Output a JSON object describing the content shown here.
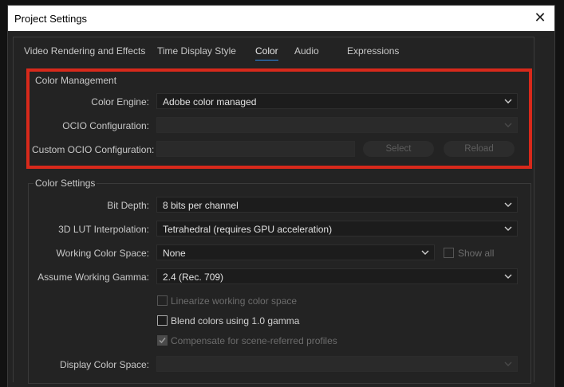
{
  "window": {
    "title": "Project Settings"
  },
  "tabs": [
    {
      "label": "Video Rendering and Effects"
    },
    {
      "label": "Time Display Style"
    },
    {
      "label": "Color",
      "active": true
    },
    {
      "label": "Audio"
    },
    {
      "label": "Expressions"
    }
  ],
  "color_management": {
    "title": "Color Management",
    "engine_label": "Color Engine:",
    "engine_value": "Adobe color managed",
    "ocio_label": "OCIO Configuration:",
    "ocio_value": "",
    "custom_ocio_label": "Custom OCIO Configuration:",
    "custom_ocio_value": "",
    "select_label": "Select",
    "reload_label": "Reload"
  },
  "color_settings": {
    "title": "Color Settings",
    "bit_depth_label": "Bit Depth:",
    "bit_depth_value": "8 bits per channel",
    "lut_label": "3D LUT Interpolation:",
    "lut_value": "Tetrahedral (requires GPU acceleration)",
    "working_space_label": "Working Color Space:",
    "working_space_value": "None",
    "show_all_label": "Show all",
    "gamma_label": "Assume Working Gamma:",
    "gamma_value": "2.4 (Rec. 709)",
    "linearize_label": "Linearize working color space",
    "linearize_checked": false,
    "blend_label": "Blend colors using 1.0 gamma",
    "blend_checked": false,
    "compensate_label": "Compensate for scene-referred profiles",
    "compensate_checked": true,
    "display_space_label": "Display Color Space:",
    "display_space_value": ""
  },
  "colors": {
    "accent": "#2d8ceb",
    "highlight_border": "#d8291b",
    "background": "#232323"
  }
}
